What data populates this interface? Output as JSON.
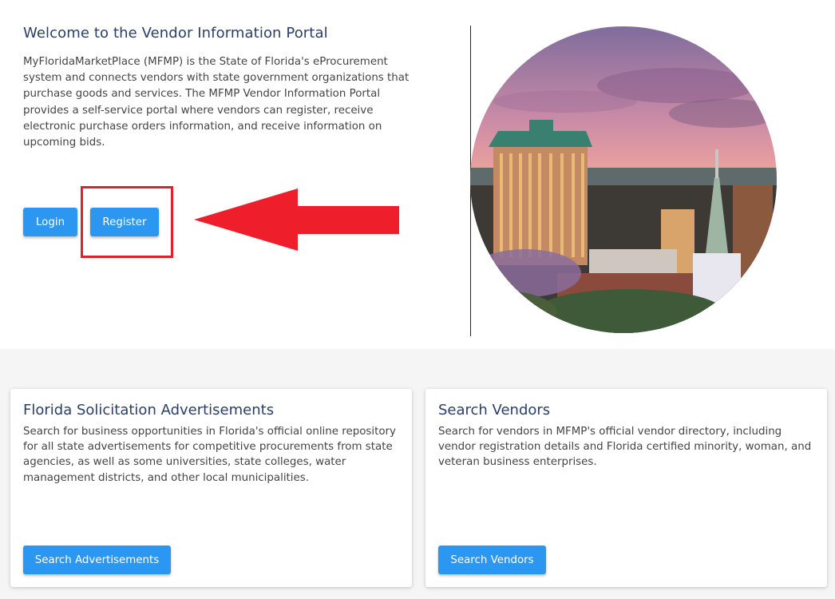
{
  "welcome": {
    "title": "Welcome to the Vendor Information Portal",
    "description": "MyFloridaMarketPlace (MFMP) is the State of Florida's eProcurement system and connects vendors with state government organizations that purchase goods and services. The MFMP Vendor Information Portal provides a self-service portal where vendors can register, receive electronic purchase orders information, and receive information on upcoming bids.",
    "login_label": "Login",
    "register_label": "Register"
  },
  "annotation": {
    "color": "#e0202a"
  },
  "colors": {
    "primary_button": "#2c97f0",
    "heading": "#2b3f66"
  },
  "cards": [
    {
      "title": "Florida Solicitation Advertisements",
      "description": "Search for business opportunities in Florida's official online repository for all state advertisements for competitive procurements from state agencies, as well as some universities, state colleges, water management districts, and other local municipalities.",
      "button_label": "Search Advertisements"
    },
    {
      "title": "Search Vendors",
      "description": "Search for vendors in MFMP's official vendor directory, including vendor registration details and Florida certified minority, woman, and veteran business enterprises.",
      "button_label": "Search Vendors"
    }
  ]
}
